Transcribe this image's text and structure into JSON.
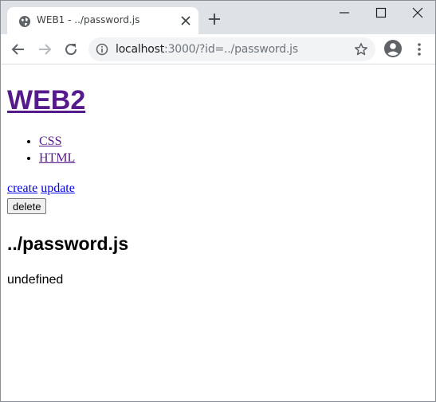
{
  "browser": {
    "tab": {
      "title": "WEB1 - ../password.js",
      "favicon": "globe-icon"
    },
    "url": {
      "host": "localhost",
      "path": ":3000/?id=../password.js"
    },
    "icons": {
      "back": "back-arrow-icon",
      "forward": "forward-arrow-icon",
      "reload": "reload-icon",
      "info": "info-icon",
      "star": "star-icon",
      "profile": "profile-icon",
      "menu": "more-vert-icon",
      "new_tab": "plus-icon",
      "minimize": "minimize-icon",
      "maximize": "maximize-icon",
      "close": "close-icon"
    }
  },
  "page": {
    "site_title": "WEB2",
    "nav": [
      {
        "label": "CSS"
      },
      {
        "label": "HTML"
      }
    ],
    "actions": {
      "create": "create",
      "update": "update",
      "delete": "delete"
    },
    "doc_title": "../password.js",
    "doc_body": "undefined"
  },
  "colors": {
    "tabstrip": "#dee1e6",
    "omnibox": "#f1f3f4",
    "link": "#0000ee",
    "visited_link": "#551a8b",
    "icon": "#5f6368"
  }
}
